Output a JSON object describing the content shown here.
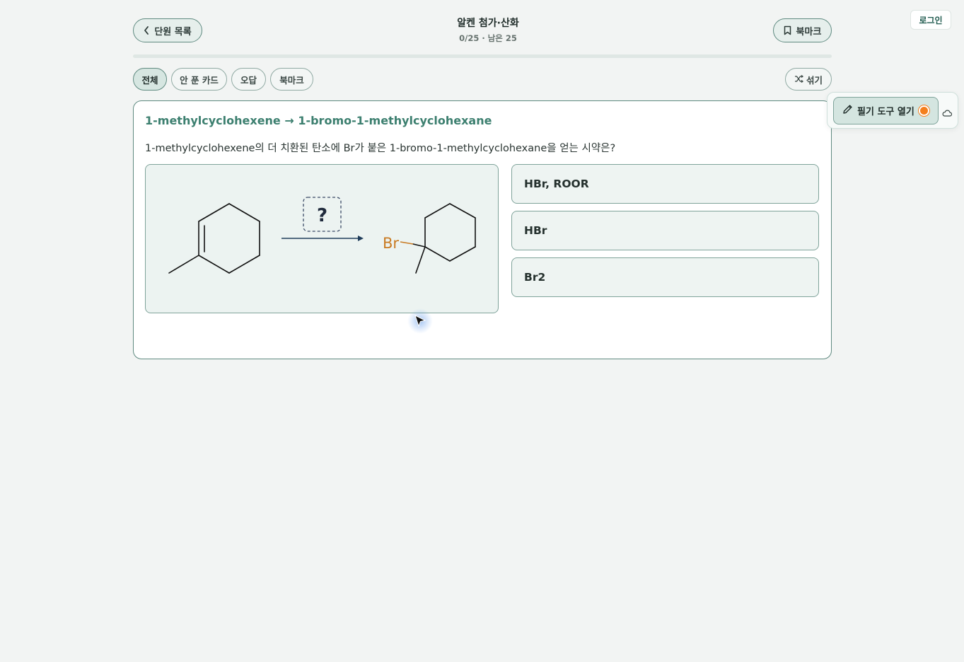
{
  "header": {
    "back_label": "단원 목록",
    "title": "알켄 첨가·산화",
    "subtitle": "0/25 · 남은 25",
    "bookmark_label": "북마크",
    "login_label": "로그인"
  },
  "progress": {
    "completed": 0,
    "total": 25,
    "fraction": 0
  },
  "filters": {
    "items": [
      {
        "label": "전체",
        "active": true
      },
      {
        "label": "안 푼 카드",
        "active": false
      },
      {
        "label": "오답",
        "active": false
      },
      {
        "label": "북마크",
        "active": false
      }
    ],
    "shuffle_label": "섞기"
  },
  "card": {
    "title": "1-methylcyclohexene → 1-bromo-1-methylcyclohexane",
    "question": "1-methylcyclohexene의 더 치환된 탄소에 Br가 붙은 1-bromo-1-methylcyclohexane을 얻는 시약은?",
    "scheme": {
      "unknown_label": "?",
      "substituent_label": "Br"
    },
    "options": [
      "HBr, ROOR",
      "HBr",
      "Br2"
    ]
  },
  "tools": {
    "open_label": "필기 도구 열기",
    "status_color": "#f47f1d",
    "cloud_icon": "cloud-icon"
  },
  "colors": {
    "accent": "#3c7f6f",
    "bromine": "#c97b23"
  }
}
